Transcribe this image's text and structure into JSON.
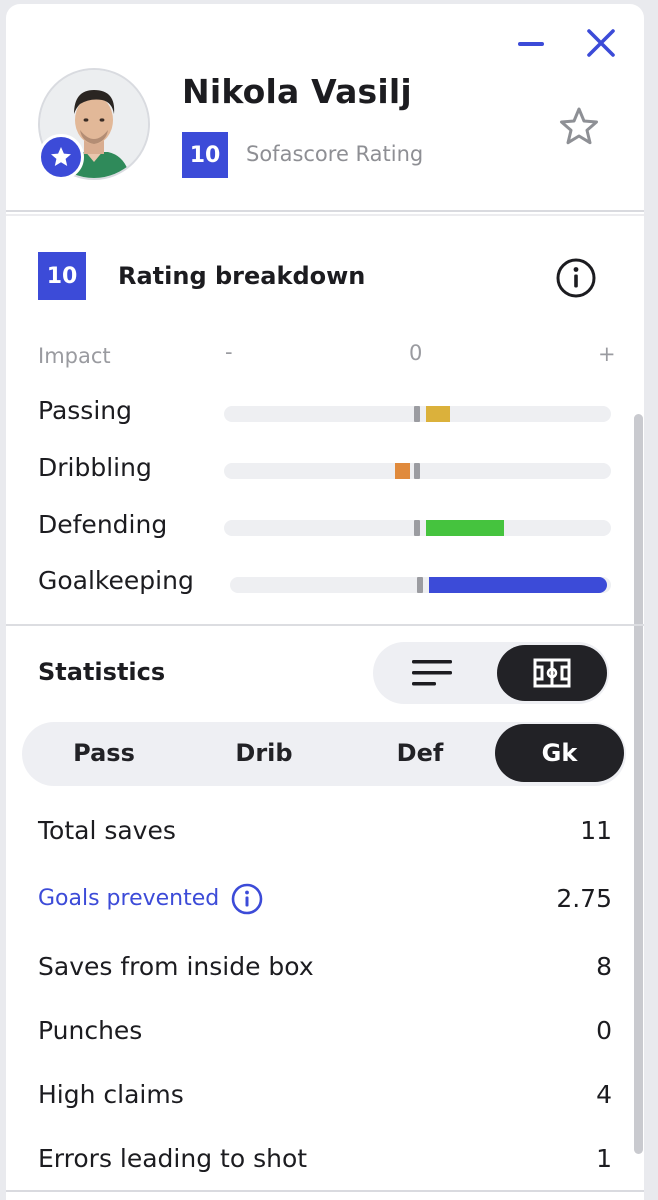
{
  "player": {
    "name": "Nikola Vasilj",
    "rating": "10",
    "rating_label": "Sofascore Rating"
  },
  "icons": {
    "minimize": "minimize-icon",
    "close": "close-icon",
    "favorite": "star-outline-icon",
    "badge": "star-badge-icon",
    "info": "info-icon",
    "list_view": "list-lines-icon",
    "pitch_view": "pitch-icon"
  },
  "breakdown": {
    "rating": "10",
    "title": "Rating breakdown",
    "impact_label": "Impact",
    "scale_minus": "-",
    "scale_zero": "0",
    "scale_plus": "+",
    "categories": [
      {
        "label": "Passing",
        "value": 0.13,
        "color": "#dbb13b"
      },
      {
        "label": "Dribbling",
        "value": -0.05,
        "color": "#e08a3c"
      },
      {
        "label": "Defending",
        "value": 0.42,
        "color": "#45c33e"
      },
      {
        "label": "Goalkeeping",
        "value": 0.98,
        "color": "#3c4bd8"
      }
    ]
  },
  "statistics": {
    "title": "Statistics",
    "tabs": [
      {
        "label": "Pass",
        "active": false
      },
      {
        "label": "Drib",
        "active": false
      },
      {
        "label": "Def",
        "active": false
      },
      {
        "label": "Gk",
        "active": true
      }
    ],
    "rows": [
      {
        "label": "Total saves",
        "value": "11"
      },
      {
        "label": "Goals prevented",
        "value": "2.75",
        "link": true
      },
      {
        "label": "Saves from inside box",
        "value": "8"
      },
      {
        "label": "Punches",
        "value": "0"
      },
      {
        "label": "High claims",
        "value": "4"
      },
      {
        "label": "Errors leading to shot",
        "value": "1"
      }
    ]
  },
  "colors": {
    "accent": "#3c4bd8",
    "dark": "#222226",
    "track": "#eeeff2"
  }
}
